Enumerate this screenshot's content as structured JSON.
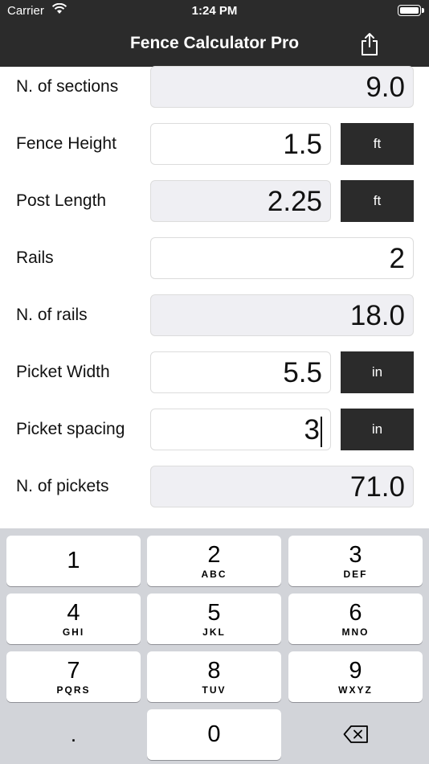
{
  "status_bar": {
    "carrier": "Carrier",
    "time": "1:24 PM"
  },
  "nav": {
    "title": "Fence Calculator Pro",
    "share_icon": "share-icon"
  },
  "rows": [
    {
      "label": "N. of sections",
      "value": "9.0",
      "readonly": true,
      "unit": null
    },
    {
      "label": "Fence Height",
      "value": "1.5",
      "readonly": false,
      "unit": "ft"
    },
    {
      "label": "Post Length",
      "value": "2.25",
      "readonly": true,
      "unit": "ft"
    },
    {
      "label": "Rails",
      "value": "2",
      "readonly": false,
      "unit": null
    },
    {
      "label": "N. of rails",
      "value": "18.0",
      "readonly": true,
      "unit": null
    },
    {
      "label": "Picket Width",
      "value": "5.5",
      "readonly": false,
      "unit": "in"
    },
    {
      "label": "Picket spacing",
      "value": "3",
      "readonly": false,
      "unit": "in",
      "focused": true
    },
    {
      "label": "N. of pickets",
      "value": "71.0",
      "readonly": true,
      "unit": null
    }
  ],
  "keypad": {
    "keys": [
      {
        "num": "1",
        "letters": ""
      },
      {
        "num": "2",
        "letters": "ABC"
      },
      {
        "num": "3",
        "letters": "DEF"
      },
      {
        "num": "4",
        "letters": "GHI"
      },
      {
        "num": "5",
        "letters": "JKL"
      },
      {
        "num": "6",
        "letters": "MNO"
      },
      {
        "num": "7",
        "letters": "PQRS"
      },
      {
        "num": "8",
        "letters": "TUV"
      },
      {
        "num": "9",
        "letters": "WXYZ"
      }
    ],
    "dot": ".",
    "zero": "0",
    "delete_icon": "backspace-icon"
  },
  "colors": {
    "bar": "#2b2b2b",
    "readonly_field": "#efeff3",
    "keyboard_bg": "#d2d4d9"
  }
}
